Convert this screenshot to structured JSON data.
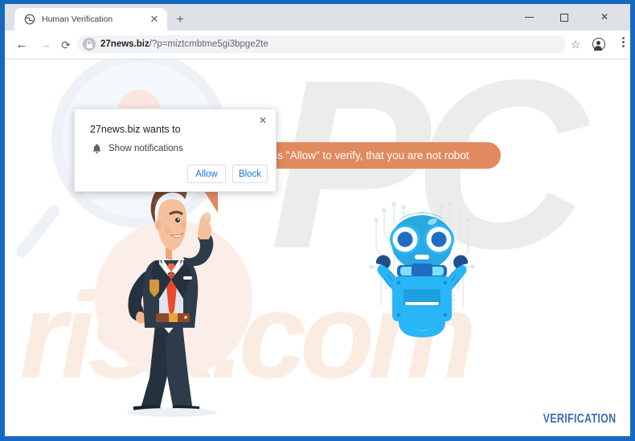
{
  "window": {
    "controls": {
      "minimize": "—",
      "maximize": "□",
      "close": "✕"
    }
  },
  "tabs": [
    {
      "title": "Human Verification",
      "favicon": "globe-icon",
      "close": "✕",
      "active": true
    }
  ],
  "new_tab_label": "+",
  "toolbar": {
    "back": "←",
    "forward": "→",
    "reload": "⟳",
    "star": "☆",
    "menu": "three-dot-icon",
    "profile": "profile-icon"
  },
  "omnibox": {
    "lock_icon": "lock-icon",
    "domain": "27news.biz",
    "path": "/?p=miztcmbtme5gi3bpge2te",
    "full_url": "27news.biz/?p=miztcmbtme5gi3bpge2te"
  },
  "notification_dialog": {
    "title": "27news.biz wants to",
    "permission": "Show notifications",
    "permission_icon": "bell-icon",
    "allow_label": "Allow",
    "block_label": "Block",
    "close_label": "✕"
  },
  "page": {
    "bubble_text": "Press \"Allow\" to verify, that you are not robot",
    "bubble_color": "#e18a5f",
    "footer_label": "VERIFICATION",
    "footer_color": "#3f6bb5",
    "watermark_primary": "PC",
    "watermark_secondary": "risk.com",
    "characters": [
      {
        "name": "businessman-illustration"
      },
      {
        "name": "robot-illustration"
      }
    ]
  },
  "colors": {
    "frame_blue": "#1769c0",
    "tabstrip": "#dee1e6",
    "omnibox": "#f1f3f4",
    "link_blue": "#1a73e8",
    "bubble_orange": "#e18a5f",
    "robot_blue": "#29b6f6"
  }
}
